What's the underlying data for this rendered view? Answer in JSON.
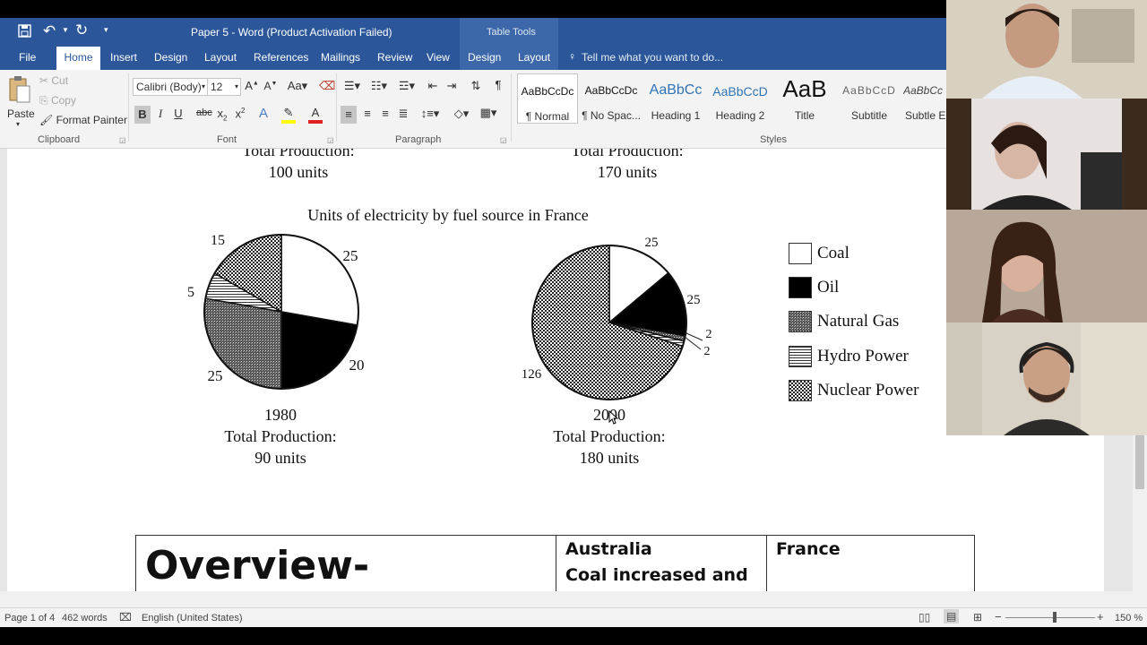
{
  "titlebar": {
    "doc_title": "Paper 5 - Word (Product Activation Failed)",
    "table_tools": "Table Tools"
  },
  "tabs": {
    "file": "File",
    "home": "Home",
    "insert": "Insert",
    "design": "Design",
    "layout": "Layout",
    "references": "References",
    "mailings": "Mailings",
    "review": "Review",
    "view": "View",
    "table_design": "Design",
    "table_layout": "Layout",
    "tell_me": "Tell me what you want to do..."
  },
  "ribbon": {
    "clipboard": {
      "paste": "Paste",
      "cut": "Cut",
      "copy": "Copy",
      "format_painter": "Format Painter",
      "label": "Clipboard"
    },
    "font": {
      "name": "Calibri (Body)",
      "size": "12",
      "label": "Font"
    },
    "paragraph": {
      "label": "Paragraph"
    },
    "styles": {
      "label": "Styles",
      "items": [
        {
          "preview": "AaBbCcDc",
          "name": "¶ Normal"
        },
        {
          "preview": "AaBbCcDc",
          "name": "¶ No Spac..."
        },
        {
          "preview": "AaBbCc",
          "name": "Heading 1"
        },
        {
          "preview": "AaBbCcD",
          "name": "Heading 2"
        },
        {
          "preview": "AaB",
          "name": "Title"
        },
        {
          "preview": "AaBbCcD",
          "name": "Subtitle"
        },
        {
          "preview": "AaBbCc",
          "name": "Subtle Em"
        }
      ]
    }
  },
  "document": {
    "top_left": {
      "line1": "Total Production:",
      "line2": "100 units"
    },
    "top_right": {
      "line1": "Total Production:",
      "line2": "170 units"
    },
    "chart_title": "Units of electricity by fuel source in France",
    "pie_1980": {
      "labels": [
        "15",
        "25",
        "5",
        "20",
        "25"
      ],
      "year": "1980",
      "prod": "Total Production:",
      "units": "90 units"
    },
    "pie_2000": {
      "labels": [
        "25",
        "25",
        "2",
        "2",
        "126"
      ],
      "year": "2000",
      "prod": "Total Production:",
      "units": "180 units"
    },
    "legend": [
      "Coal",
      "Oil",
      "Natural Gas",
      "Hydro Power",
      "Nuclear Power"
    ],
    "table": {
      "overview": "Overview-",
      "australia_title": "Australia",
      "australia_text": "Coal increased and",
      "france_title": "France"
    }
  },
  "chart_data": [
    {
      "type": "pie",
      "title": "Units of electricity by fuel source in France",
      "subtitle": "1980",
      "categories": [
        "Coal",
        "Oil",
        "Natural Gas",
        "Hydro Power",
        "Nuclear Power"
      ],
      "values": [
        25,
        20,
        25,
        5,
        15
      ]
    },
    {
      "type": "pie",
      "title": "Units of electricity by fuel source in France",
      "subtitle": "2000",
      "categories": [
        "Coal",
        "Oil",
        "Natural Gas",
        "Hydro Power",
        "Nuclear Power"
      ],
      "values": [
        25,
        25,
        2,
        2,
        126
      ]
    }
  ],
  "statusbar": {
    "page": "Page 1 of 4",
    "words": "462 words",
    "language": "English (United States)",
    "zoom": "150 %"
  }
}
